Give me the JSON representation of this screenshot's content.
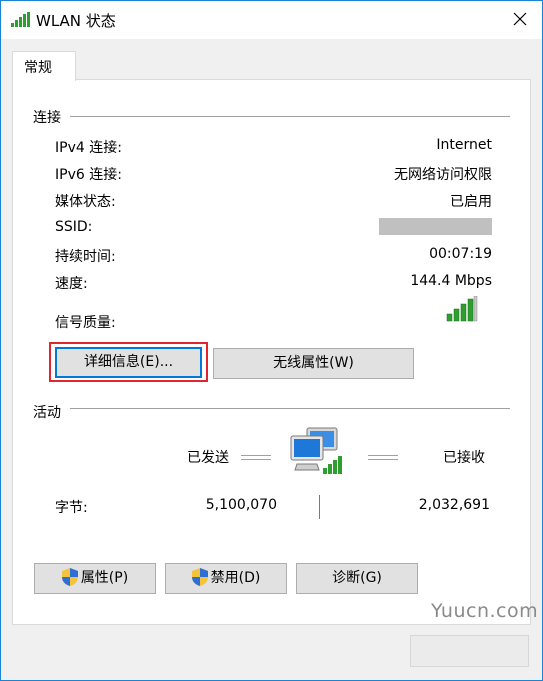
{
  "window": {
    "title": "WLAN 状态"
  },
  "tabs": [
    {
      "label": "常规"
    }
  ],
  "connection": {
    "heading": "连接",
    "rows": [
      {
        "label": "IPv4 连接:",
        "value": "Internet"
      },
      {
        "label": "IPv6 连接:",
        "value": "无网络访问权限"
      },
      {
        "label": "媒体状态:",
        "value": "已启用"
      },
      {
        "label": "SSID:",
        "value": ""
      },
      {
        "label": "持续时间:",
        "value": "00:07:19"
      },
      {
        "label": "速度:",
        "value": "144.4 Mbps"
      }
    ],
    "signal_label": "信号质量:",
    "signal_bars": 4,
    "details_button": "详细信息(E)...",
    "wireless_button": "无线属性(W)"
  },
  "activity": {
    "heading": "活动",
    "sent_label": "已发送",
    "received_label": "已接收",
    "bytes_label": "字节:",
    "bytes_sent": "5,100,070",
    "bytes_received": "2,032,691"
  },
  "buttons": {
    "properties": "属性(P)",
    "disable": "禁用(D)",
    "diagnose": "诊断(G)"
  },
  "watermark": "Yuucn.com",
  "colors": {
    "accent": "#0078d7",
    "highlight": "#e1252f",
    "signal": "#2e9f2e"
  }
}
